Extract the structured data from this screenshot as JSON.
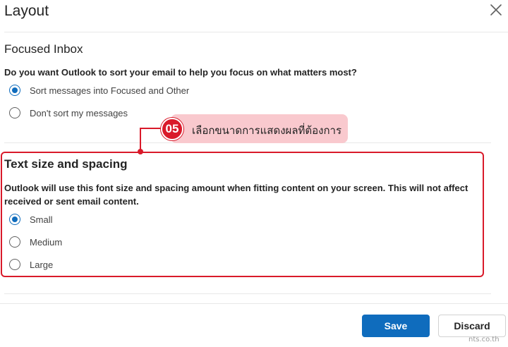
{
  "dialog": {
    "title": "Layout",
    "close_icon": "close-icon"
  },
  "focused_inbox": {
    "heading": "Focused Inbox",
    "question": "Do you want Outlook to sort your email to help you focus on what matters most?",
    "options": [
      {
        "label": "Sort messages into Focused and Other",
        "selected": true
      },
      {
        "label": "Don't sort my messages",
        "selected": false
      }
    ]
  },
  "callout": {
    "step": "05",
    "text": "เลือกขนาดการแสดงผลที่ต้องการ",
    "color": "#d91a2a",
    "background": "#f9c9ce"
  },
  "text_size": {
    "heading": "Text size and spacing",
    "description": "Outlook will use this font size and spacing amount when fitting content on your screen. This will not affect received or sent email content.",
    "options": [
      {
        "label": "Small",
        "selected": true
      },
      {
        "label": "Medium",
        "selected": false
      },
      {
        "label": "Large",
        "selected": false
      }
    ]
  },
  "footer": {
    "save_label": "Save",
    "discard_label": "Discard"
  },
  "watermark": "nts.co.th",
  "colors": {
    "accent": "#0f6cbd",
    "highlight": "#d91a2a"
  }
}
